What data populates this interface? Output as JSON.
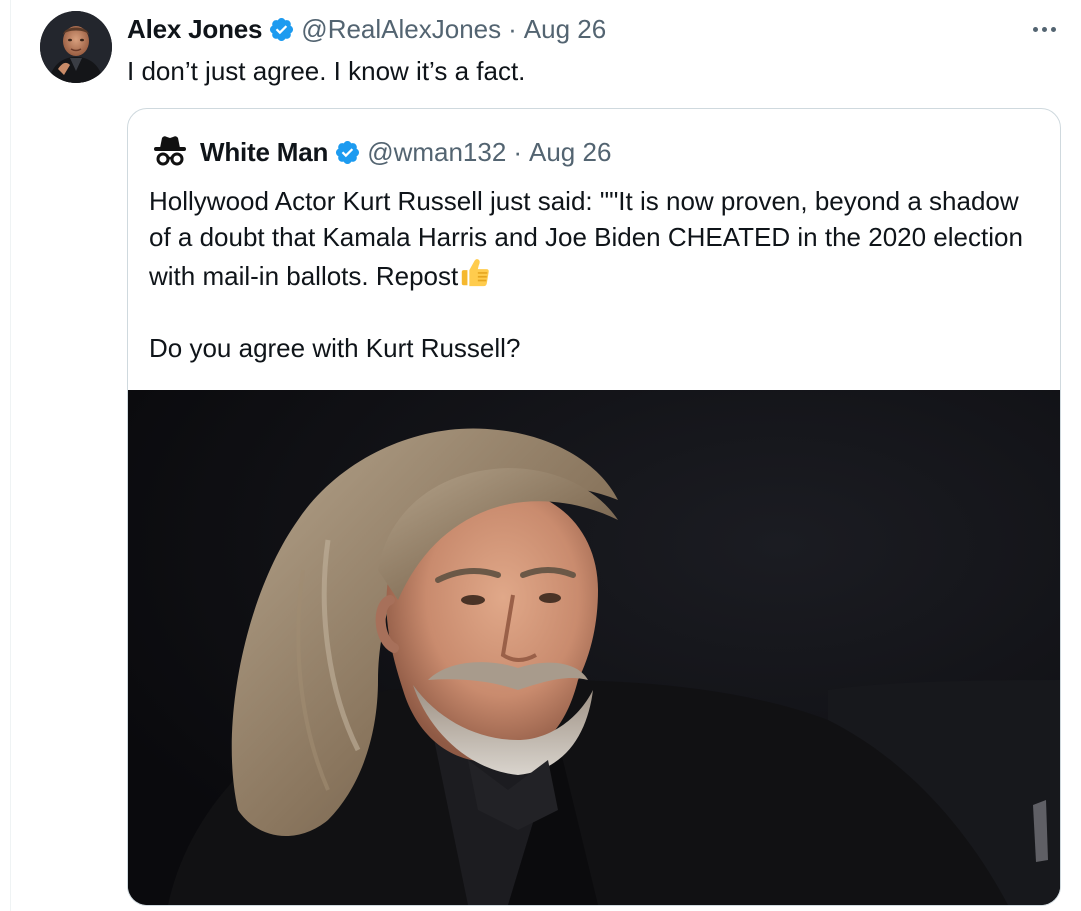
{
  "tweet": {
    "author_name": "Alex Jones",
    "author_handle": "@RealAlexJones",
    "separator": "·",
    "date": "Aug 26",
    "text": "I don’t just agree. I know it’s a fact."
  },
  "quoted_tweet": {
    "author_name": "White Man",
    "author_handle": "@wman132",
    "separator": "·",
    "date": "Aug 26",
    "text_line1": "Hollywood Actor Kurt Russell just said: \"\"It is now proven, beyond a shadow of a doubt that Kamala Harris and Joe Biden CHEATED in the 2020 election with mail-in ballots. Repost",
    "text_line2": "Do you agree with Kurt Russell?",
    "media_description": "photo"
  },
  "icons": {
    "verified": "verified-badge-icon",
    "more": "more-options-icon",
    "thumbs_up": "thumbs-up-emoji-icon"
  },
  "colors": {
    "verified_blue": "#1d9bf0",
    "secondary_text": "#536471",
    "primary_text": "#0f1419",
    "border": "#cfd9de"
  }
}
